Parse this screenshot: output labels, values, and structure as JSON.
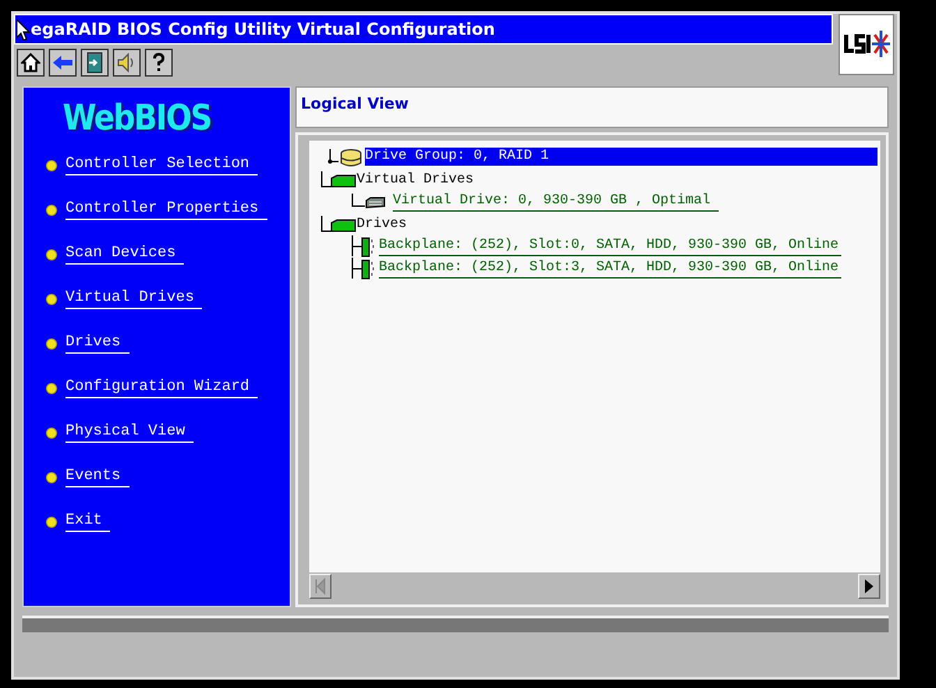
{
  "window": {
    "title": "egaRAID BIOS Config Utility Virtual Configuration"
  },
  "toolbar": [
    {
      "kind": "home"
    },
    {
      "kind": "back"
    },
    {
      "kind": "exit"
    },
    {
      "kind": "sound"
    },
    {
      "kind": "help"
    }
  ],
  "sidebar": {
    "logo": "WebBIOS",
    "items": [
      {
        "label": "Controller Selection"
      },
      {
        "label": "Controller Properties"
      },
      {
        "label": "Scan Devices"
      },
      {
        "label": "Virtual Drives"
      },
      {
        "label": "Drives"
      },
      {
        "label": "Configuration Wizard"
      },
      {
        "label": "Physical View"
      },
      {
        "label": "Events"
      },
      {
        "label": "Exit"
      }
    ]
  },
  "panel": {
    "title": "Logical View",
    "tree": [
      {
        "kind": "group",
        "label": "Drive Group: 0, RAID 1",
        "selected": true,
        "children": [
          {
            "kind": "folder",
            "label": "Virtual Drives",
            "selected": false,
            "children": [
              {
                "kind": "vd",
                "label": "Virtual Drive: 0, 930-390 GB , Optimal",
                "selected": false
              }
            ]
          },
          {
            "kind": "folder",
            "label": "Drives",
            "selected": false,
            "children": [
              {
                "kind": "disk",
                "label": "Backplane: (252), Slot:0, SATA, HDD, 930-390 GB, Online",
                "selected": false
              },
              {
                "kind": "disk",
                "label": "Backplane: (252), Slot:3, SATA, HDD, 930-390 GB, Online",
                "selected": false
              }
            ]
          }
        ]
      }
    ]
  }
}
